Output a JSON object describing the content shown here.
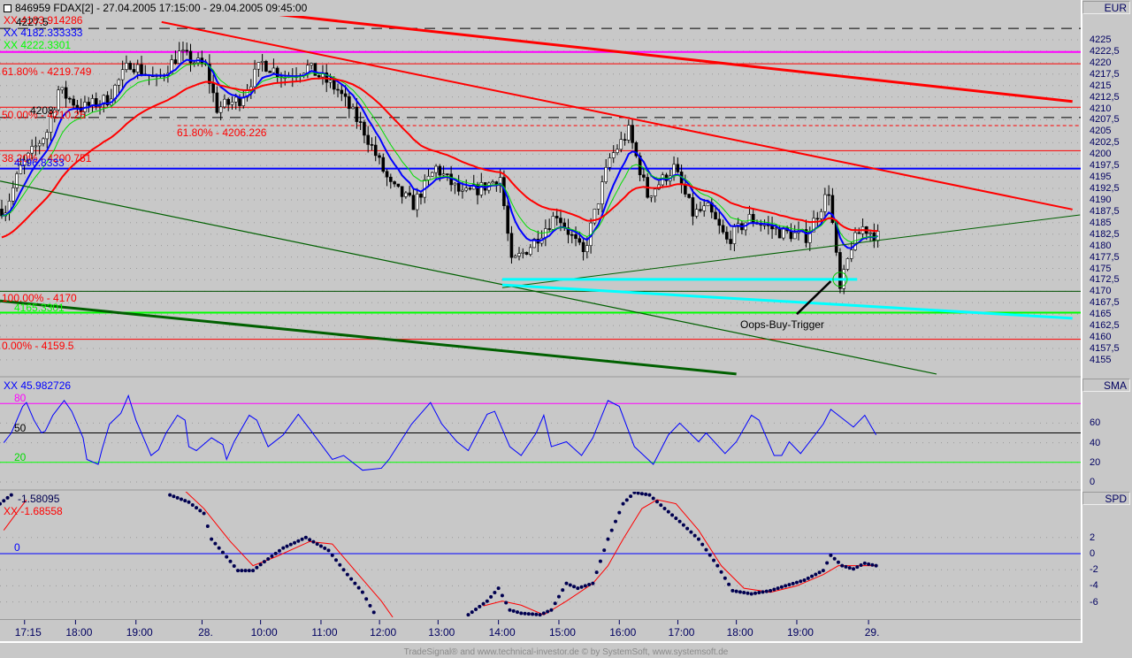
{
  "header": {
    "title": "846959  FDAX[2] - 27.04.2005 17:15:00 - 29.04.2005 09:45:00",
    "currency": "EUR"
  },
  "overlay_labels": [
    {
      "text": "XX 4183.914286",
      "color": "#ff0000"
    },
    {
      "text": "4227.5",
      "color": "#000000"
    },
    {
      "text": "XX 4182.333333",
      "color": "#0000ff"
    },
    {
      "text": "XX 4222.3301",
      "color": "#00ff00"
    },
    {
      "text": "61.80% - 4219.749",
      "color": "#ff0000"
    },
    {
      "text": "50.00% - 4210.25",
      "color": "#ff0000"
    },
    {
      "text": "4208",
      "color": "#000000"
    },
    {
      "text": "61.80% - 4206.226",
      "color": "#ff0000"
    },
    {
      "text": "38.20% - 4200.751",
      "color": "#ff0000"
    },
    {
      "text": "4196.8333",
      "color": "#0000ff"
    },
    {
      "text": "100.00% - 4170",
      "color": "#ff0000"
    },
    {
      "text": "4165.3301",
      "color": "#00ff00"
    },
    {
      "text": "0.00% - 4159.5",
      "color": "#ff0000"
    },
    {
      "text": "Oops-Buy-Trigger",
      "color": "#000000"
    }
  ],
  "sma_panel": {
    "name": "SMA",
    "value_label": "XX 45.982726",
    "levels": [
      {
        "text": "80",
        "value": 80,
        "color": "#ff00ff"
      },
      {
        "text": "50",
        "value": 50,
        "color": "#000000"
      },
      {
        "text": "20",
        "value": 20,
        "color": "#00ff00"
      }
    ],
    "ticks": [
      "60",
      "40",
      "20",
      "0"
    ]
  },
  "spd_panel": {
    "name": "SPD",
    "value_label_1": "-1.58095",
    "value_label_2": "XX -1.68558",
    "zero_label": "0",
    "ticks": [
      "2",
      "0",
      "-2",
      "-4",
      "-6"
    ]
  },
  "price_ticks": [
    "4225",
    "4222,5",
    "4220",
    "4217,5",
    "4215",
    "4212,5",
    "4210",
    "4207,5",
    "4205",
    "4202,5",
    "4200",
    "4197,5",
    "4195",
    "4192,5",
    "4190",
    "4187,5",
    "4185",
    "4182,5",
    "4180",
    "4177,5",
    "4175",
    "4172,5",
    "4170",
    "4167,5",
    "4165",
    "4162,5",
    "4160",
    "4157,5",
    "4155"
  ],
  "time_labels": [
    {
      "text": "17:15",
      "bar": 6.5
    },
    {
      "text": "18:00",
      "bar": 20
    },
    {
      "text": "19:00",
      "bar": 36
    },
    {
      "text": "28.",
      "bar": 53.5
    },
    {
      "text": "10:00",
      "bar": 69
    },
    {
      "text": "11:00",
      "bar": 85
    },
    {
      "text": "12:00",
      "bar": 100.5
    },
    {
      "text": "13:00",
      "bar": 116
    },
    {
      "text": "14:00",
      "bar": 132
    },
    {
      "text": "15:00",
      "bar": 148
    },
    {
      "text": "16:00",
      "bar": 164
    },
    {
      "text": "17:00",
      "bar": 179.5
    },
    {
      "text": "18:00",
      "bar": 195
    },
    {
      "text": "19:00",
      "bar": 211
    },
    {
      "text": "29.",
      "bar": 230
    }
  ],
  "footer": "TradeSignal® and www.technical-investor.de © by  SystemSoft, www.systemsoft.de",
  "chart_data": {
    "type": "candlestick",
    "title": "846959 FDAX[2] - 27.04.2005 17:15:00 - 29.04.2005 09:45:00",
    "x_unit": "15-minute bar index",
    "x_range": [
      0,
      286
    ],
    "y_range": [
      4150,
      4234
    ],
    "ylabel": "EUR",
    "close_keypoints": [
      [
        1,
        4188
      ],
      [
        5,
        4197
      ],
      [
        12,
        4205
      ],
      [
        15,
        4214
      ],
      [
        21,
        4210
      ],
      [
        28,
        4212
      ],
      [
        34,
        4220
      ],
      [
        41,
        4216
      ],
      [
        47,
        4222
      ],
      [
        54,
        4219
      ],
      [
        57,
        4210
      ],
      [
        63,
        4212
      ],
      [
        69,
        4220
      ],
      [
        75,
        4217
      ],
      [
        81,
        4219
      ],
      [
        89,
        4214
      ],
      [
        96,
        4205
      ],
      [
        103,
        4193
      ],
      [
        109,
        4189
      ],
      [
        115,
        4197
      ],
      [
        122,
        4191
      ],
      [
        128,
        4193
      ],
      [
        132,
        4195
      ],
      [
        135,
        4176
      ],
      [
        140,
        4180
      ],
      [
        147,
        4187
      ],
      [
        154,
        4178
      ],
      [
        161,
        4199
      ],
      [
        166,
        4205
      ],
      [
        171,
        4191
      ],
      [
        178,
        4197
      ],
      [
        183,
        4187
      ],
      [
        187,
        4188
      ],
      [
        192,
        4181
      ],
      [
        198,
        4186
      ],
      [
        206,
        4183
      ],
      [
        213,
        4182
      ],
      [
        219,
        4192
      ],
      [
        222,
        4170
      ],
      [
        225,
        4180
      ],
      [
        228,
        4184
      ],
      [
        232,
        4182
      ]
    ],
    "moving_averages": [
      {
        "color": "#0000ff",
        "period": 8
      },
      {
        "color": "#00dd00",
        "period": 13
      },
      {
        "color": "#ff0000",
        "period": 34
      }
    ],
    "horizontal_lines": [
      {
        "price": 4227.5,
        "color": "#000000",
        "style": "dashed"
      },
      {
        "price": 4222.3301,
        "color": "#ff00ff",
        "style": "solid",
        "width": 2
      },
      {
        "price": 4219.749,
        "color": "#ff0000",
        "style": "solid"
      },
      {
        "price": 4210.25,
        "color": "#ff0000",
        "style": "solid"
      },
      {
        "price": 4208,
        "color": "#000000",
        "style": "dashed"
      },
      {
        "price": 4206.226,
        "color": "#ff0000",
        "style": "dotted",
        "from_bar": 47
      },
      {
        "price": 4200.751,
        "color": "#ff0000",
        "style": "solid"
      },
      {
        "price": 4196.8333,
        "color": "#0000ff",
        "style": "solid",
        "width": 2
      },
      {
        "price": 4170,
        "color": "#005000",
        "style": "solid"
      },
      {
        "price": 4165.3301,
        "color": "#00ff00",
        "style": "solid",
        "width": 2
      },
      {
        "price": 4159.5,
        "color": "#ff0000",
        "style": "solid"
      }
    ],
    "trendlines": [
      {
        "from": [
          38.6,
          4233.7
        ],
        "to": [
          284,
          4211.5
        ],
        "color": "#ff0000",
        "width": 3
      },
      {
        "from": [
          42.8,
          4228.9
        ],
        "to": [
          284,
          4187.9
        ],
        "color": "#ff0000",
        "width": 2
      },
      {
        "from": [
          0,
          4194.1
        ],
        "to": [
          248,
          4151.9
        ],
        "color": "#006000",
        "width": 1.2
      },
      {
        "from": [
          0,
          4167.9
        ],
        "to": [
          195,
          4151.9
        ],
        "color": "#006000",
        "width": 3
      },
      {
        "from": [
          133,
          4170.8
        ],
        "to": [
          286,
          4186.7
        ],
        "color": "#006000",
        "width": 1
      },
      {
        "from": [
          133,
          4172.6
        ],
        "to": [
          227,
          4172.6
        ],
        "color": "#00ffff",
        "width": 3
      },
      {
        "from": [
          133,
          4171.4
        ],
        "to": [
          284,
          4164.1
        ],
        "color": "#00ffff",
        "width": 3
      },
      {
        "from": [
          211,
          4165
        ],
        "to": [
          220,
          4172.2
        ],
        "color": "#000000",
        "width": 2.5
      }
    ],
    "marker_circle": {
      "bar": 222,
      "price": 4172.6,
      "color": "#00cc00"
    },
    "sma_oscillator": [
      [
        1,
        40
      ],
      [
        3,
        50
      ],
      [
        6,
        77
      ],
      [
        7,
        81
      ],
      [
        9,
        63
      ],
      [
        11,
        50
      ],
      [
        12,
        52
      ],
      [
        14,
        68
      ],
      [
        17,
        83
      ],
      [
        19,
        72
      ],
      [
        20,
        63
      ],
      [
        22,
        45
      ],
      [
        23,
        23
      ],
      [
        26,
        18
      ],
      [
        27,
        33
      ],
      [
        29,
        59
      ],
      [
        32,
        70
      ],
      [
        34,
        88
      ],
      [
        36,
        63
      ],
      [
        40,
        27
      ],
      [
        42,
        33
      ],
      [
        44,
        50
      ],
      [
        47,
        68
      ],
      [
        49,
        63
      ],
      [
        50,
        36
      ],
      [
        52,
        32
      ],
      [
        56,
        45
      ],
      [
        59,
        38
      ],
      [
        60,
        23
      ],
      [
        62,
        41
      ],
      [
        66,
        68
      ],
      [
        68,
        63
      ],
      [
        71,
        36
      ],
      [
        75,
        48
      ],
      [
        79,
        69
      ],
      [
        82,
        54
      ],
      [
        88,
        23
      ],
      [
        91,
        27
      ],
      [
        96,
        12
      ],
      [
        101,
        14
      ],
      [
        103,
        23
      ],
      [
        109,
        59
      ],
      [
        114,
        81
      ],
      [
        117,
        59
      ],
      [
        121,
        41
      ],
      [
        124,
        32
      ],
      [
        129,
        69
      ],
      [
        131,
        72
      ],
      [
        135,
        36
      ],
      [
        138,
        27
      ],
      [
        142,
        50
      ],
      [
        144,
        68
      ],
      [
        146,
        36
      ],
      [
        150,
        41
      ],
      [
        154,
        27
      ],
      [
        157,
        45
      ],
      [
        161,
        83
      ],
      [
        164,
        77
      ],
      [
        168,
        36
      ],
      [
        173,
        18
      ],
      [
        177,
        48
      ],
      [
        180,
        60
      ],
      [
        185,
        41
      ],
      [
        187,
        50
      ],
      [
        192,
        29
      ],
      [
        195,
        41
      ],
      [
        199,
        68
      ],
      [
        201,
        63
      ],
      [
        205,
        27
      ],
      [
        207,
        27
      ],
      [
        209,
        41
      ],
      [
        212,
        29
      ],
      [
        218,
        59
      ],
      [
        220,
        74
      ],
      [
        226,
        56
      ],
      [
        229,
        68
      ],
      [
        232,
        48
      ]
    ],
    "spd_dots_segments": [
      [
        [
          0,
          6.2
        ],
        [
          3,
          7.3
        ]
      ],
      [
        [
          45,
          7.3
        ],
        [
          50,
          6.4
        ],
        [
          54,
          5
        ],
        [
          56,
          1.8
        ],
        [
          60,
          -0.4
        ],
        [
          63,
          -2.1
        ],
        [
          67,
          -2.1
        ],
        [
          70,
          -1
        ],
        [
          75,
          0.7
        ],
        [
          81,
          2
        ],
        [
          87,
          0.4
        ],
        [
          92,
          -2.6
        ],
        [
          96,
          -4.8
        ],
        [
          99,
          -7.3
        ]
      ],
      [
        [
          124,
          -7.6
        ],
        [
          129,
          -5.9
        ],
        [
          132,
          -4.3
        ],
        [
          135,
          -7
        ],
        [
          138,
          -7.4
        ],
        [
          143,
          -7.6
        ],
        [
          146,
          -7
        ],
        [
          150,
          -3.7
        ],
        [
          153,
          -4.3
        ],
        [
          157,
          -3.7
        ],
        [
          161,
          1.8
        ],
        [
          165,
          6.2
        ],
        [
          168,
          7.6
        ],
        [
          172,
          7.3
        ],
        [
          176,
          5.6
        ],
        [
          180,
          4
        ],
        [
          185,
          1.8
        ],
        [
          190,
          -1.5
        ],
        [
          194,
          -4.6
        ],
        [
          199,
          -5
        ],
        [
          204,
          -4.6
        ],
        [
          208,
          -4
        ],
        [
          213,
          -3.3
        ],
        [
          218,
          -2.1
        ],
        [
          220,
          -0.2
        ],
        [
          223,
          -1.5
        ],
        [
          226,
          -1.9
        ],
        [
          229,
          -1.2
        ],
        [
          232,
          -1.5
        ]
      ]
    ],
    "spd_signal_segments": [
      [
        [
          1,
          2.9
        ],
        [
          7,
          6.7
        ]
      ],
      [
        [
          49,
          7.8
        ],
        [
          54,
          5.6
        ],
        [
          61,
          1.5
        ],
        [
          67,
          -1.5
        ],
        [
          73,
          -0.4
        ],
        [
          82,
          1.5
        ],
        [
          88,
          1.2
        ],
        [
          94,
          -2.1
        ],
        [
          101,
          -5.9
        ],
        [
          104,
          -7.9
        ]
      ],
      [
        [
          128,
          -6.5
        ],
        [
          133,
          -5.9
        ],
        [
          138,
          -6.4
        ],
        [
          144,
          -7.6
        ],
        [
          150,
          -5.9
        ],
        [
          157,
          -3.7
        ],
        [
          161,
          -1.5
        ],
        [
          165,
          1.8
        ],
        [
          170,
          5.6
        ],
        [
          174,
          6.7
        ],
        [
          179,
          6.2
        ],
        [
          185,
          2.9
        ],
        [
          191,
          -1.5
        ],
        [
          197,
          -4.3
        ],
        [
          204,
          -4.8
        ],
        [
          211,
          -4
        ],
        [
          218,
          -2.6
        ],
        [
          222,
          -1.5
        ],
        [
          232,
          -1.5
        ]
      ]
    ]
  }
}
